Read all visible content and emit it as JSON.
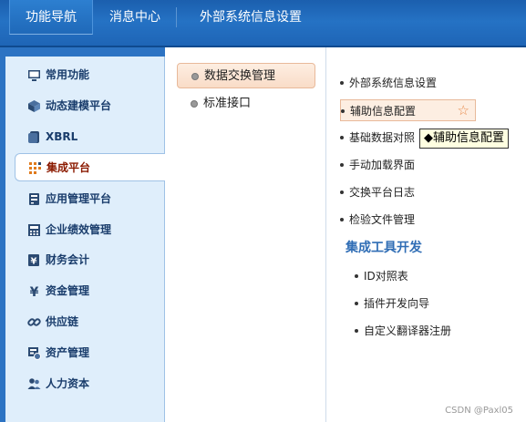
{
  "topbar": {
    "tabs": [
      {
        "label": "功能导航",
        "active": true
      },
      {
        "label": "消息中心",
        "active": false
      },
      {
        "label": "外部系统信息设置",
        "active": false
      }
    ]
  },
  "leftnav": {
    "items": [
      {
        "label": "常用功能",
        "icon": "monitor-icon"
      },
      {
        "label": "动态建模平台",
        "icon": "cube-icon"
      },
      {
        "label": "XBRL",
        "icon": "document-icon"
      },
      {
        "label": "集成平台",
        "icon": "grid-icon",
        "active": true
      },
      {
        "label": "应用管理平台",
        "icon": "server-icon"
      },
      {
        "label": "企业绩效管理",
        "icon": "calculator-icon"
      },
      {
        "label": "财务会计",
        "icon": "yen-book-icon"
      },
      {
        "label": "资金管理",
        "icon": "yen-icon"
      },
      {
        "label": "供应链",
        "icon": "link-icon"
      },
      {
        "label": "资产管理",
        "icon": "asset-icon"
      },
      {
        "label": "人力资本",
        "icon": "people-icon"
      }
    ]
  },
  "midpane": {
    "items": [
      {
        "label": "数据交换管理",
        "active": true
      },
      {
        "label": "标准接口",
        "active": false
      }
    ]
  },
  "rightpane": {
    "items": [
      {
        "label": "外部系统信息设置"
      },
      {
        "label": "辅助信息配置",
        "highlighted": true
      },
      {
        "label": "基础数据对照"
      },
      {
        "label": "手动加载界面"
      },
      {
        "label": "交换平台日志"
      },
      {
        "label": "检验文件管理"
      }
    ],
    "section_title": "集成工具开发",
    "sub_items": [
      {
        "label": "ID对照表"
      },
      {
        "label": "插件开发向导"
      },
      {
        "label": "自定义翻译器注册"
      }
    ]
  },
  "tooltip": {
    "text": "◆辅助信息配置"
  },
  "watermark": "CSDN @Paxl05",
  "colors": {
    "accent": "#1e64b5",
    "highlight": "#fdeee2",
    "title": "#2f6db5"
  }
}
